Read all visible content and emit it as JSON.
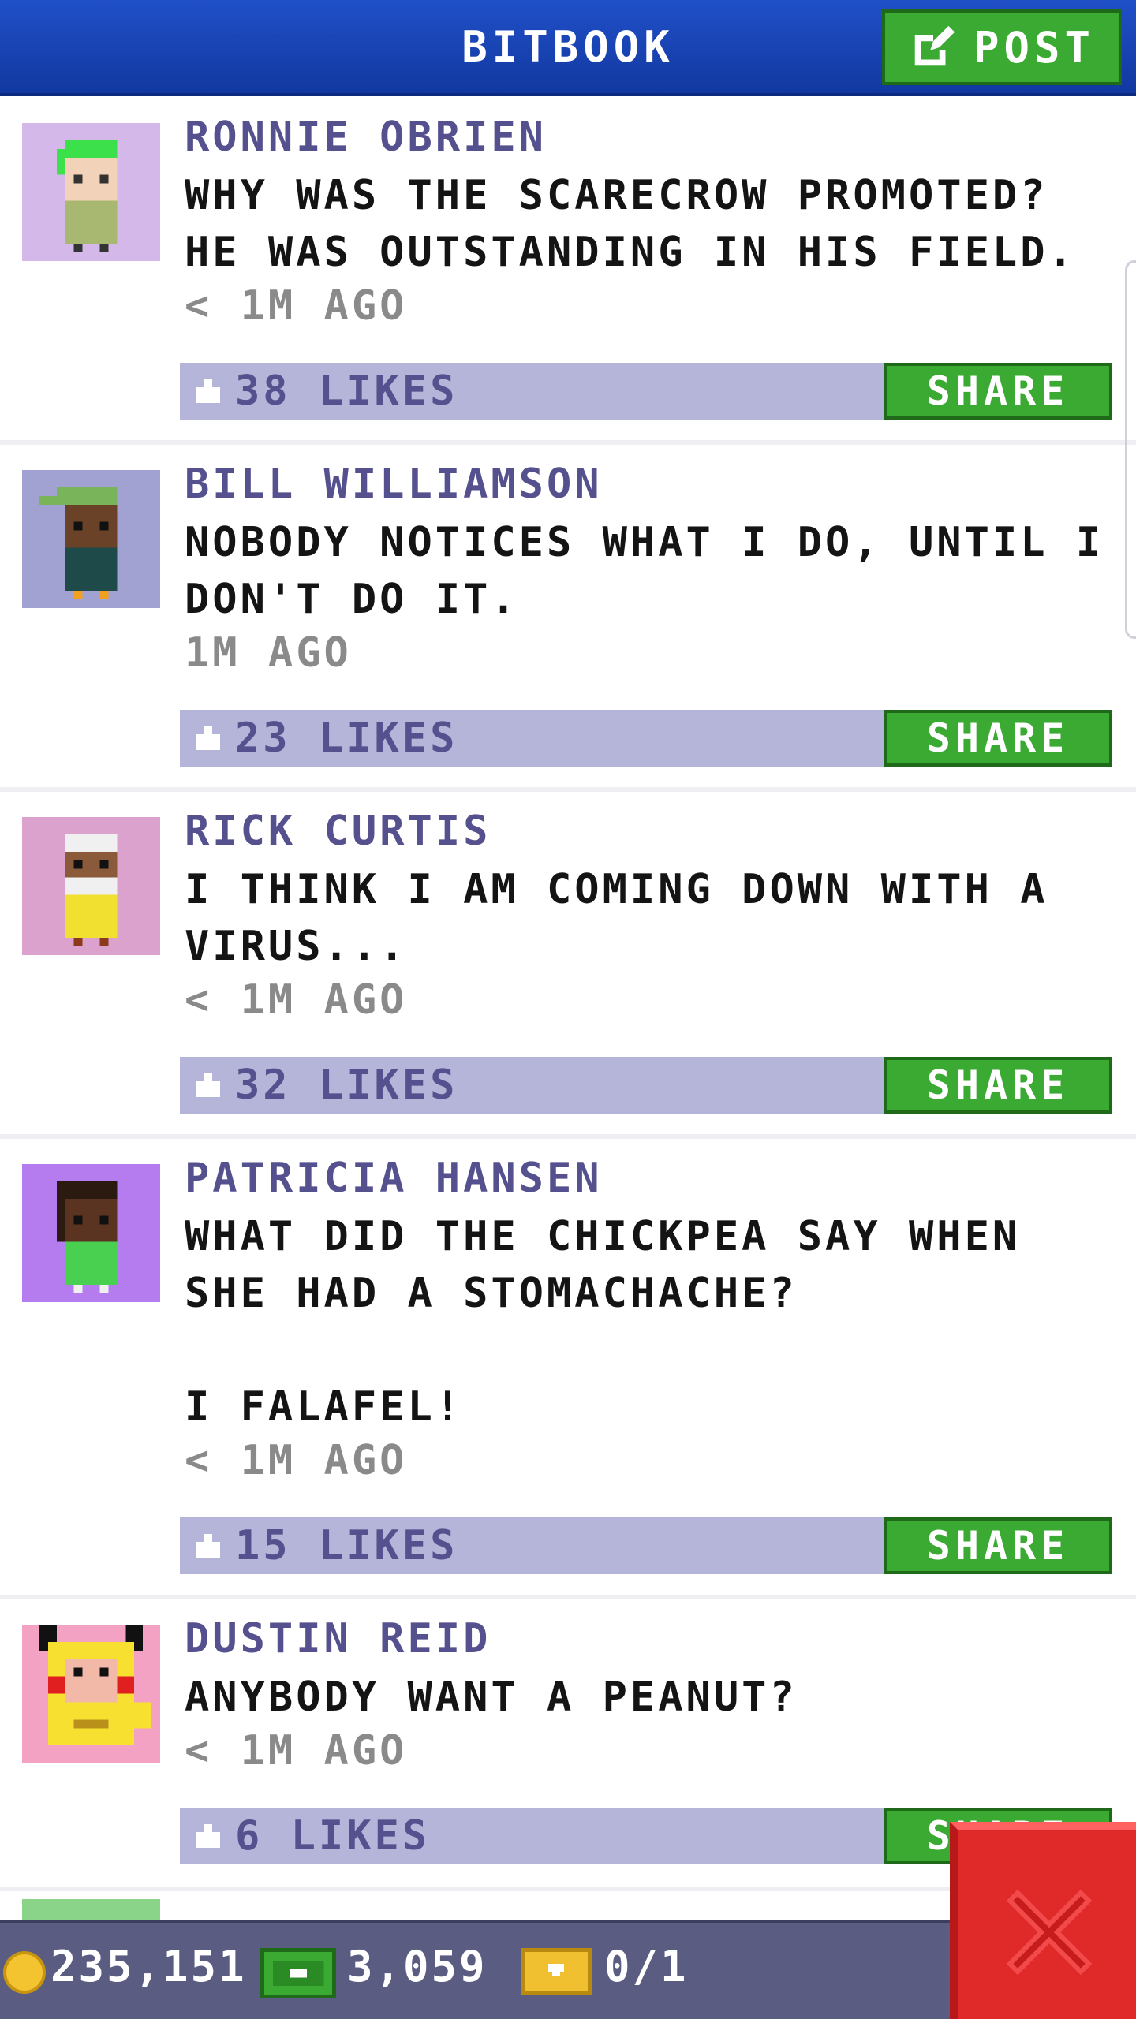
{
  "header": {
    "title": "BITBOOK",
    "post_label": "POST"
  },
  "posts": [
    {
      "author": "RONNIE OBRIEN",
      "text": "WHY WAS THE SCARECROW PROMOTED? HE WAS OUTSTANDING IN HIS FIELD.",
      "time": "< 1M AGO",
      "likes": "38 LIKES",
      "share_label": "SHARE",
      "avatar_bg": "#d4b8ea"
    },
    {
      "author": "BILL WILLIAMSON",
      "text": "NOBODY NOTICES WHAT I DO, UNTIL I DON'T DO IT.",
      "time": "1M AGO",
      "likes": "23 LIKES",
      "share_label": "SHARE",
      "avatar_bg": "#a2a2d2"
    },
    {
      "author": "RICK CURTIS",
      "text": "I THINK I AM COMING DOWN WITH A VIRUS...",
      "time": "< 1M AGO",
      "likes": "32 LIKES",
      "share_label": "SHARE",
      "avatar_bg": "#daa2cc"
    },
    {
      "author": "PATRICIA HANSEN",
      "text": "WHAT DID THE CHICKPEA SAY WHEN SHE HAD A STOMACHACHE?\n\nI FALAFEL!",
      "time": "< 1M AGO",
      "likes": "15 LIKES",
      "share_label": "SHARE",
      "avatar_bg": "#b47cee"
    },
    {
      "author": "DUSTIN REID",
      "text": "ANYBODY WANT A PEANUT?",
      "time": "< 1M AGO",
      "likes": "6 LIKES",
      "share_label": "SHARE",
      "avatar_bg": "#f4a2c4"
    }
  ],
  "footer": {
    "coins": "235,151",
    "bux": "3,059",
    "tickets": "0/1"
  },
  "colors": {
    "header_blue": "#1a46b4",
    "button_green": "#3aaa32",
    "bar_lavender": "#b4b5d8",
    "name_purple": "#55508e",
    "footer_slate": "#5a5c82",
    "close_red": "#e02a2a"
  }
}
